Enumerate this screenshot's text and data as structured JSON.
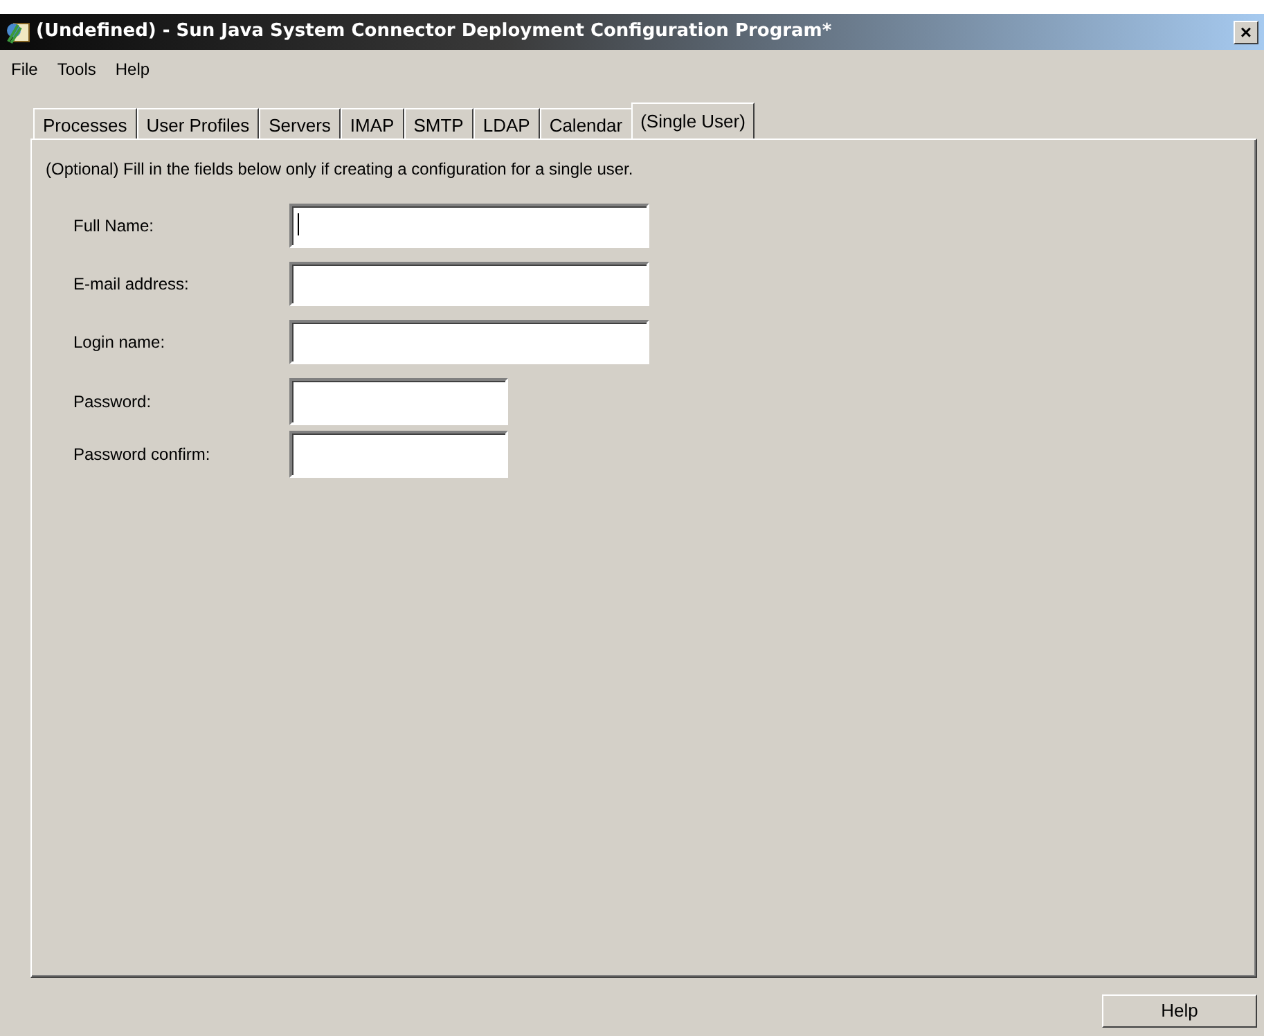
{
  "window": {
    "title": "(Undefined) - Sun Java System Connector Deployment Configuration Program*",
    "close": "×"
  },
  "menu": [
    {
      "label": "File"
    },
    {
      "label": "Tools"
    },
    {
      "label": "Help"
    }
  ],
  "tabs": [
    {
      "label": "Processes",
      "selected": false
    },
    {
      "label": "User Profiles",
      "selected": false
    },
    {
      "label": "Servers",
      "selected": false
    },
    {
      "label": "IMAP",
      "selected": false
    },
    {
      "label": "SMTP",
      "selected": false
    },
    {
      "label": "LDAP",
      "selected": false
    },
    {
      "label": "Calendar",
      "selected": false
    },
    {
      "label": "(Single User)",
      "selected": true
    }
  ],
  "intro": "(Optional) Fill in the fields below only if creating a configuration for a single user.",
  "fields": [
    {
      "label": "Full Name:",
      "kind": "wide",
      "focused": true
    },
    {
      "label": "E-mail address:",
      "kind": "wide",
      "focused": false
    },
    {
      "label": "Login name:",
      "kind": "wide",
      "focused": false
    },
    {
      "label": "Password:",
      "kind": "narrow",
      "focused": false
    },
    {
      "label": "Password confirm:",
      "kind": "narrow",
      "focused": false
    }
  ],
  "buttons": [
    {
      "label": "Help"
    }
  ]
}
